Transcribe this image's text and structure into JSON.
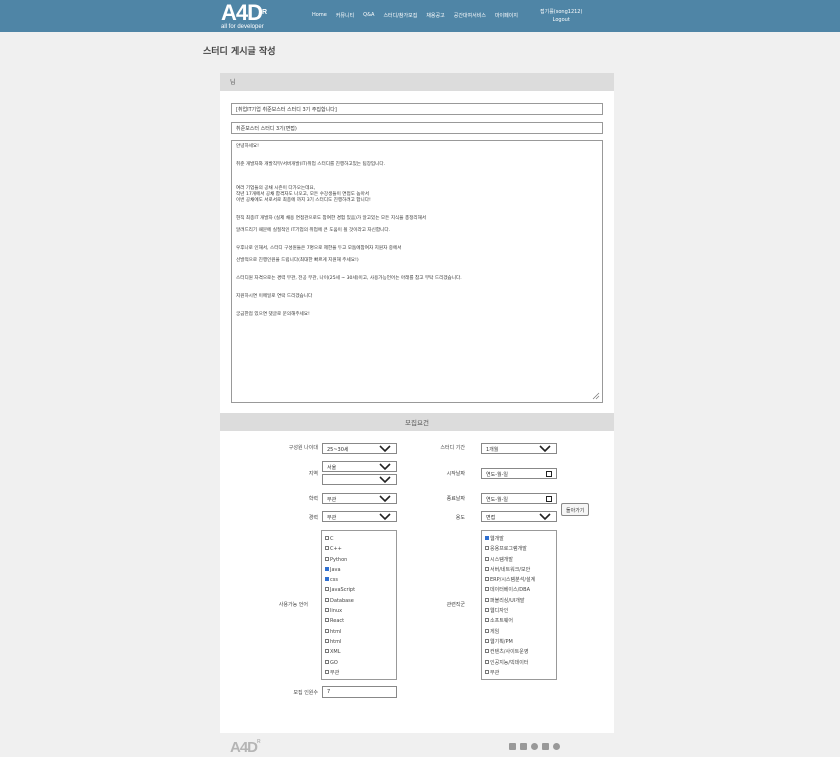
{
  "header": {
    "logo_text": "A4D",
    "logo_mark": "R",
    "logo_sub": "all for developer",
    "nav": [
      "Home",
      "커뮤니티",
      "Q&A",
      "스터디/참가모집",
      "채용공고",
      "공간대여서비스",
      "마이페이지"
    ],
    "user_name": "접기를(song1212)",
    "logout": "Logout"
  },
  "page_title": "스터디 게시글 작성",
  "form": {
    "section_label": "님",
    "title_value": "[취업IT기업 취준보스터 스터디 3기 주집합니다]",
    "subtitle_value": "취준보스터 스터디 3기(면접)",
    "body_lines": [
      "안녕하세요!",
      "",
      "",
      "취준 개발자와 개발직무/서버개발(IT)취업 스터디를 진행하고있는 팀장입니다.",
      "",
      "",
      "",
      "여러 기업들의 공채 시즌이 다가오는데요,",
      "작년 17개에서 공채 합격자도 나오고, 모든 수강생들이 면접도 높아서",
      "이번 공채에도 서로서로 최종에 까지 3기 스터디도 진행하려고 합니다!",
      "",
      "",
      "현직 최종IT 개발자 (실제 채용 면접관으로도 참여한 경험 있음)가 알고있는 모든 지식을 총정리해서",
      "",
      "알려드리기 때문에 실질적인 IT기업의 취업에 큰 도움이 될 것이라고 자신합니다.",
      "",
      "",
      "우후나로 인해서, 스터디 구성원들은 7명으로 제한을 두고 모둠에참여자 지원자 중에서",
      "",
      "선발적으로 진행인원을 드립니다(최대한 빠르게 지원해 주세요!)",
      "",
      "",
      "스터디원 자격으로는 경력 무관, 전공 무관, 나이(25세 ~ 30세)이고, 사용가능언어는 아래를 참고 부탁 드리겠습니다.",
      "",
      "",
      "지원하시면 이메일로 연락 드리겠습니다",
      "",
      "",
      "궁금한점 있으면 댓글로 문의해주세요!"
    ]
  },
  "requirements": {
    "heading": "모집요건",
    "age_label": "구성원 나이대",
    "age_value": "25~30세",
    "period_label": "스터디 기간",
    "period_value": "1개월",
    "region_label": "지역",
    "region_value": "서울",
    "region2_value": "",
    "start_label": "시작날짜",
    "start_value": "연도-월-일",
    "major_label": "학력",
    "major_value": "무관",
    "end_label": "종료날짜",
    "end_value": "연도-월-일",
    "career_label": "경력",
    "career_value": "무관",
    "purpose_label": "용도",
    "purpose_value": "면접",
    "back_button": "돌아가기",
    "lang_label": "사용가능 언어",
    "languages": [
      {
        "name": "C",
        "checked": false
      },
      {
        "name": "C++",
        "checked": false
      },
      {
        "name": "Python",
        "checked": false
      },
      {
        "name": "Java",
        "checked": true
      },
      {
        "name": "css",
        "checked": true
      },
      {
        "name": "JavaScript",
        "checked": false
      },
      {
        "name": "Database",
        "checked": false
      },
      {
        "name": "linux",
        "checked": false
      },
      {
        "name": "React",
        "checked": false
      },
      {
        "name": "html",
        "checked": false
      },
      {
        "name": "html",
        "checked": false
      },
      {
        "name": "XML",
        "checked": false
      },
      {
        "name": "GO",
        "checked": false
      },
      {
        "name": "무관",
        "checked": false
      }
    ],
    "job_label": "관련직군",
    "jobs": [
      {
        "name": "웹개발",
        "checked": true
      },
      {
        "name": "응용프로그램개발",
        "checked": false
      },
      {
        "name": "시스템개발",
        "checked": false
      },
      {
        "name": "서버/네트워크/보안",
        "checked": false
      },
      {
        "name": "ERP/시스템분석/설계",
        "checked": false
      },
      {
        "name": "데이터베이스/DBA",
        "checked": false
      },
      {
        "name": "퍼블리싱/UI개발",
        "checked": false
      },
      {
        "name": "웹디자인",
        "checked": false
      },
      {
        "name": "소프트웨어",
        "checked": false
      },
      {
        "name": "게임",
        "checked": false
      },
      {
        "name": "웹기획/PM",
        "checked": false
      },
      {
        "name": "컨텐츠/사이트운영",
        "checked": false
      },
      {
        "name": "인공지능/빅데이터",
        "checked": false
      },
      {
        "name": "무관",
        "checked": false
      }
    ],
    "count_label": "모집 인원수",
    "count_value": "7"
  },
  "footer": {
    "logo_text": "A4D",
    "logo_mark": "R",
    "icons": [
      "instagram-icon",
      "youtube-icon",
      "facebook-icon",
      "blog-icon",
      "kakao-icon"
    ]
  }
}
